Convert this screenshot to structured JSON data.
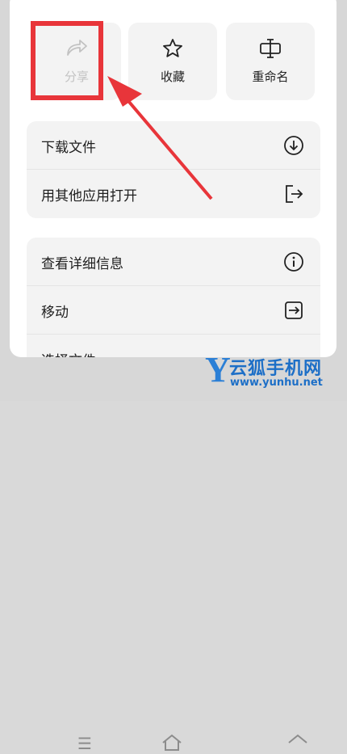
{
  "tiles": {
    "share_label": "分享",
    "favorite_label": "收藏",
    "rename_label": "重命名"
  },
  "menu_group_1": {
    "download": "下载文件",
    "open_with": "用其他应用打开"
  },
  "menu_group_2": {
    "details": "查看详细信息",
    "move": "移动",
    "select": "选择文件"
  },
  "watermark": {
    "letter": "Y",
    "name": "云狐手机网",
    "url": "www.yunhu.net"
  },
  "colors": {
    "highlight": "#e8353a",
    "watermark": "#1d6fc7"
  }
}
